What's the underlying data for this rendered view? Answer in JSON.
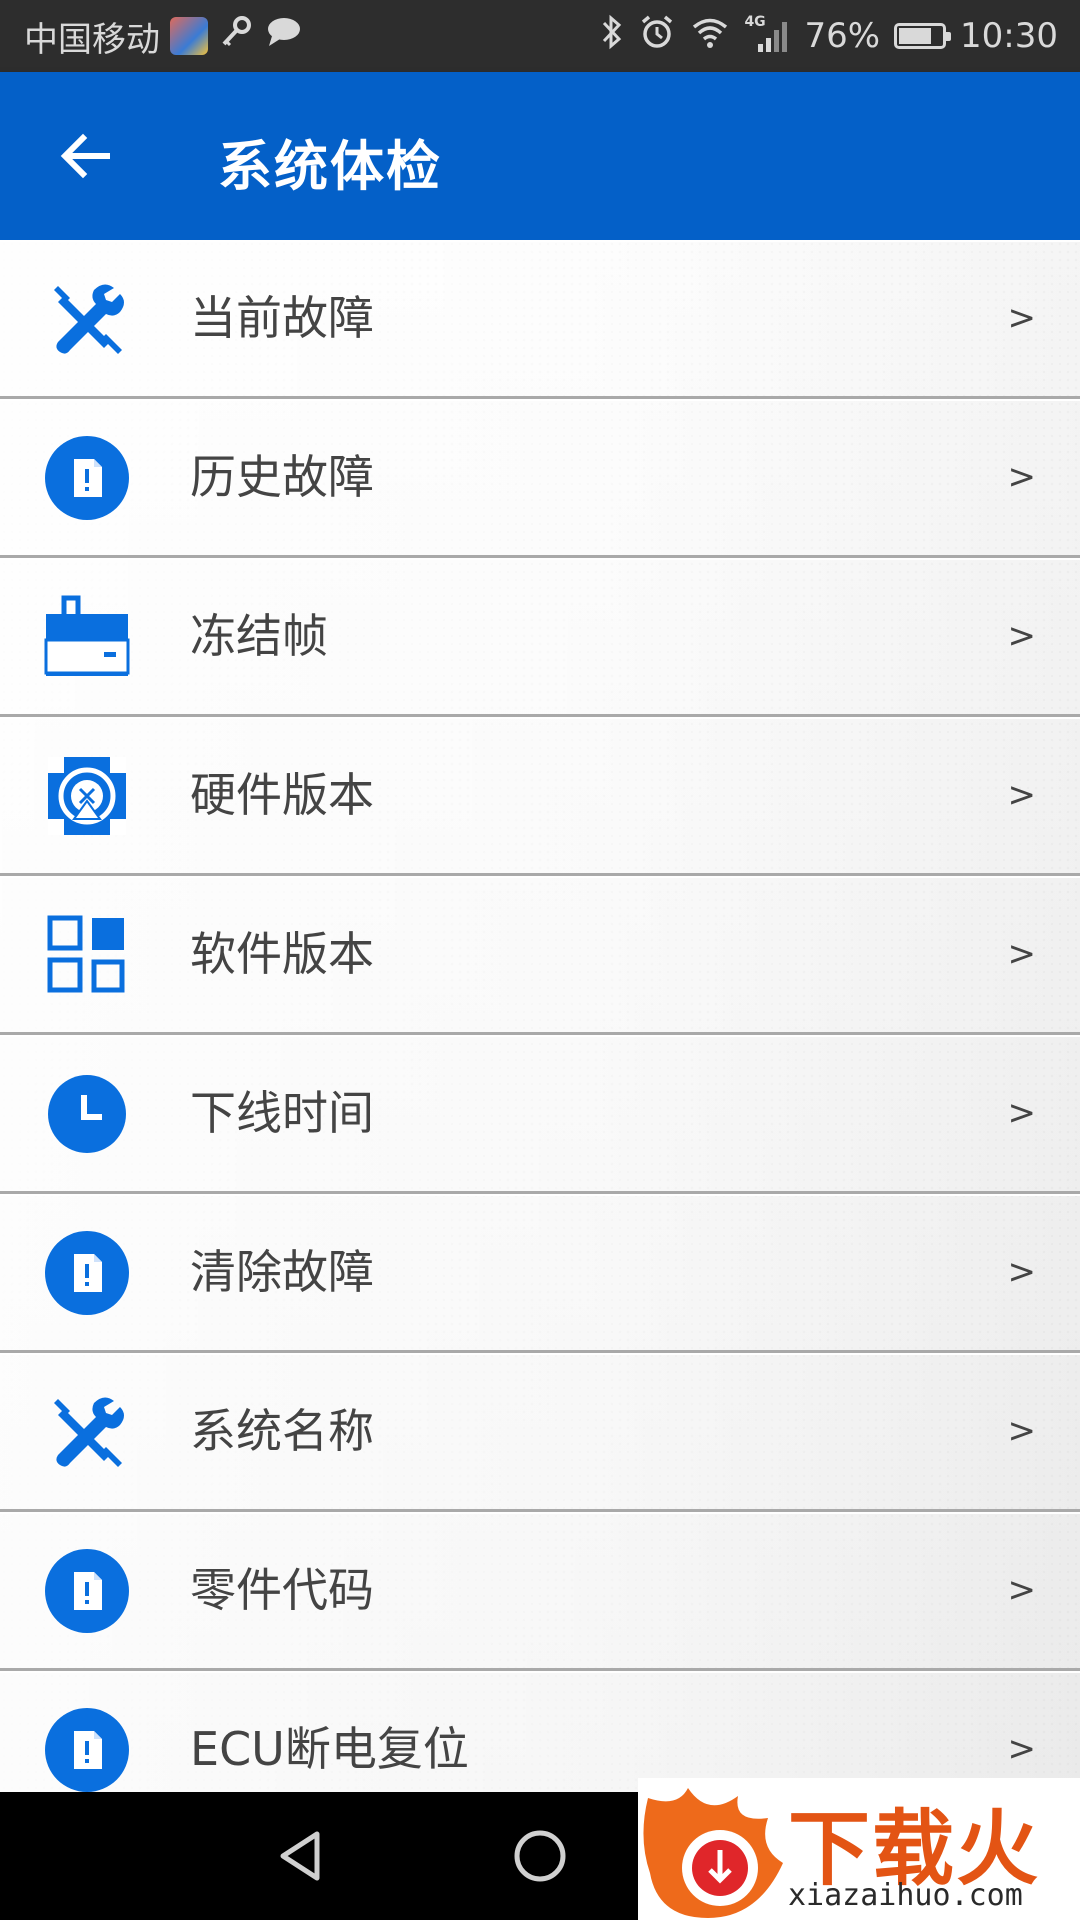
{
  "status_bar": {
    "carrier": "中国移动",
    "network": "4G",
    "battery": "76%",
    "battery_level": 0.76,
    "time": "10:30"
  },
  "app_bar": {
    "title": "系统体检",
    "back_icon": "arrow-left-icon"
  },
  "theme": {
    "primary": "#0460c8",
    "icon_blue": "#0a6fde",
    "text": "#444444"
  },
  "menu": {
    "items": [
      {
        "label": "当前故障",
        "icon": "tools-icon",
        "arrow": ">"
      },
      {
        "label": "历史故障",
        "icon": "document-alert-icon",
        "arrow": ">"
      },
      {
        "label": "冻结帧",
        "icon": "briefcase-icon",
        "arrow": ">"
      },
      {
        "label": "硬件版本",
        "icon": "hardware-icon",
        "arrow": ">"
      },
      {
        "label": "软件版本",
        "icon": "grid-icon",
        "arrow": ">"
      },
      {
        "label": "下线时间",
        "icon": "clock-icon",
        "arrow": ">"
      },
      {
        "label": "清除故障",
        "icon": "document-alert-icon",
        "arrow": ">"
      },
      {
        "label": "系统名称",
        "icon": "tools-icon",
        "arrow": ">"
      },
      {
        "label": "零件代码",
        "icon": "document-alert-icon",
        "arrow": ">"
      },
      {
        "label": "ECU断电复位",
        "icon": "document-alert-icon",
        "arrow": ">"
      }
    ]
  },
  "nav_bar": {
    "back": "back-triangle-icon",
    "home": "home-circle-icon"
  },
  "watermark": {
    "text": "下载火",
    "url": "xiazaihuo.com"
  }
}
